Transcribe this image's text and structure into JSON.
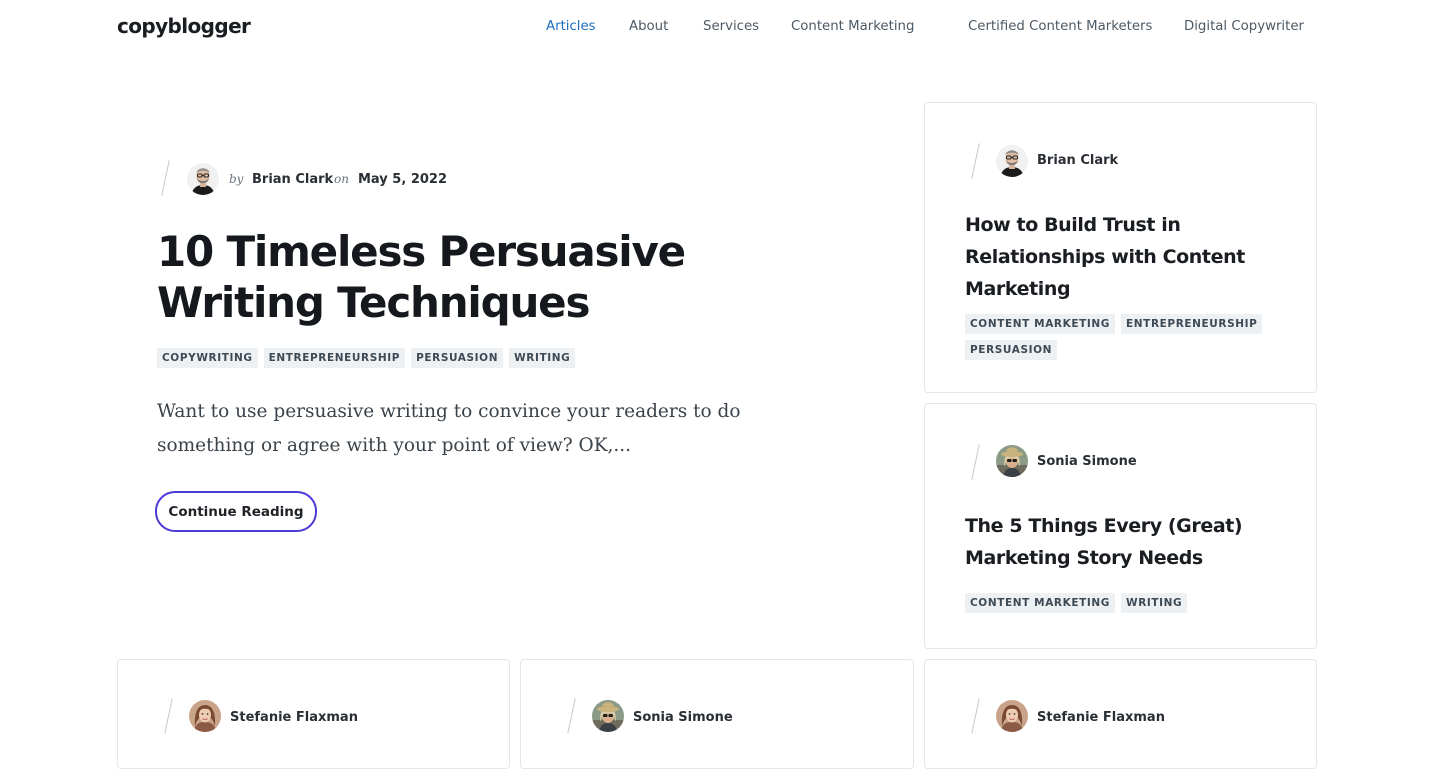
{
  "header": {
    "logo": "copyblogger",
    "nav": [
      {
        "label": "Articles",
        "active": true
      },
      {
        "label": "About"
      },
      {
        "label": "Services"
      },
      {
        "label": "Content Marketing"
      },
      {
        "label": "Certified Content Marketers"
      },
      {
        "label": "Digital Copywriter"
      }
    ],
    "active_color": "#1d6fbf"
  },
  "featured": {
    "by": "by",
    "author": "Brian Clark",
    "on": "on",
    "date": "May 5, 2022",
    "title": "10 Timeless Persuasive Writing Techniques",
    "tags": [
      "COPYWRITING",
      "ENTREPRENEURSHIP",
      "PERSUASION",
      "WRITING"
    ],
    "excerpt": "Want to use persuasive writing to convince your readers to do something or agree with your point of view? OK,...",
    "button": "Continue Reading",
    "button_border_color": "#4b3ad6"
  },
  "cards": [
    {
      "author": "Brian Clark",
      "title": "How to Build Trust in Relationships with Content Marketing",
      "tags": [
        "CONTENT MARKETING",
        "ENTREPRENEURSHIP",
        "PERSUASION"
      ]
    },
    {
      "author": "Sonia Simone",
      "title": "The 5 Things Every (Great) Marketing Story Needs",
      "tags": [
        "CONTENT MARKETING",
        "WRITING"
      ]
    },
    {
      "author": "Stefanie Flaxman"
    },
    {
      "author": "Sonia Simone"
    },
    {
      "author": "Stefanie Flaxman"
    }
  ]
}
